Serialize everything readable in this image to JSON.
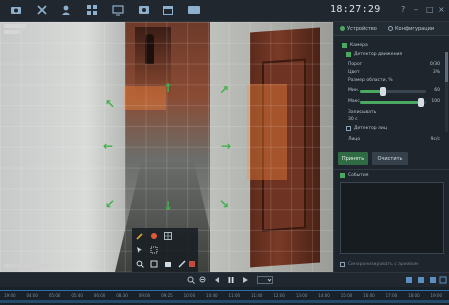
{
  "clock": "18:27:29",
  "window_controls": [
    "?",
    "–",
    "□",
    "×"
  ],
  "toolbar": {
    "icons": [
      "camera-icon",
      "tools-icon",
      "user-icon",
      "grid-icon",
      "monitor-icon",
      "record-icon",
      "calendar-icon",
      "display-icon"
    ]
  },
  "video": {
    "ptz_arrows": [
      "↖",
      "↑",
      "↗",
      "←",
      "→",
      "↙",
      "↓",
      "↘"
    ]
  },
  "settings": {
    "tab1": "Устройство",
    "tab2": "Конфигурации",
    "camera_enabled_label": "Камера",
    "motion_detector_label": "Детектор движения",
    "sensitivity_label": "Порог",
    "sensitivity_value": "0/30",
    "area_label": "Цвет",
    "area_value": "3%",
    "zone_label": "Размер области, %",
    "min_label": "Мин.",
    "min_value": "60",
    "min_fill": 0.35,
    "max_label": "Макс.",
    "max_value": "100",
    "max_fill": 0.92,
    "record_label": "Записывать",
    "record_value": "30 c",
    "noise_label": "Детектор лиц",
    "last_label": "Лицо",
    "last_value": "9с/с",
    "apply_label": "Принять",
    "reset_label": "Очистить",
    "events_label": "События",
    "archive_hint": "Синхронизировать с архивом"
  },
  "timeline": {
    "ticks": [
      "19:00",
      "04:00",
      "05:00",
      "05:40",
      "06:00",
      "08:30",
      "09:00",
      "09:25",
      "10:00",
      "10:40",
      "11:00",
      "11:40",
      "12:00",
      "13:00",
      "14:00",
      "15:00",
      "16:00",
      "17:00",
      "18:00",
      "19:00"
    ]
  }
}
